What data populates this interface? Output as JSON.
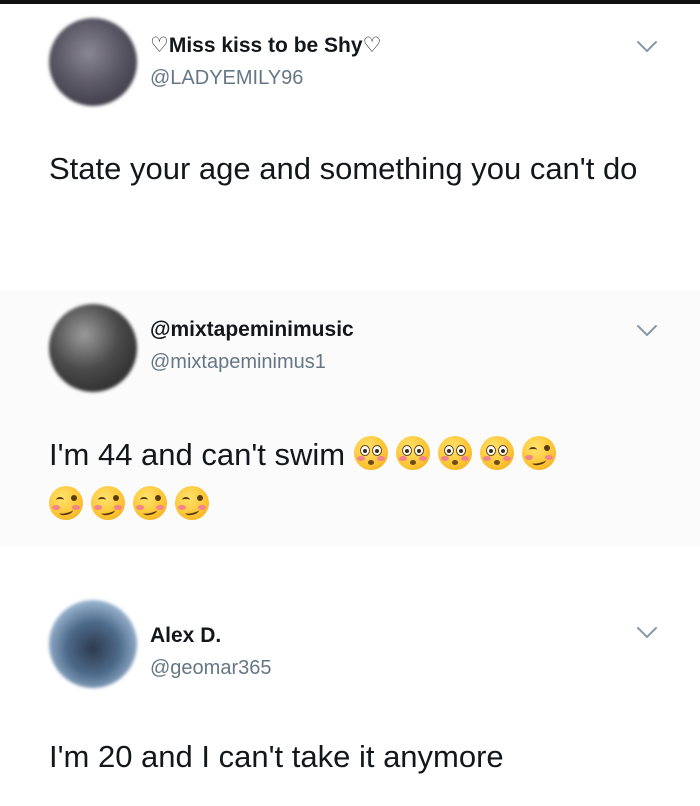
{
  "tweets": [
    {
      "display_name": "♡Miss kiss to be Shy♡",
      "handle": "@LADYEMILY96",
      "text": "State your age and something you can't do",
      "emojis": []
    },
    {
      "display_name": "@mixtapeminimusic",
      "handle": "@mixtapeminimus1",
      "text": "I'm 44 and can't swim ",
      "emojis": [
        "flushed-face",
        "flushed-face",
        "flushed-face",
        "flushed-face",
        "woozy-face",
        "woozy-face",
        "woozy-face",
        "woozy-face",
        "woozy-face"
      ]
    },
    {
      "display_name": "Alex D.",
      "handle": "@geomar365",
      "text": "I'm 20 and I can't take it anymore",
      "emojis": []
    }
  ],
  "colors": {
    "name": "#14171a",
    "handle": "#657786",
    "chevron": "#8899a6"
  },
  "icons": {
    "menu": "chevron-down-icon"
  }
}
